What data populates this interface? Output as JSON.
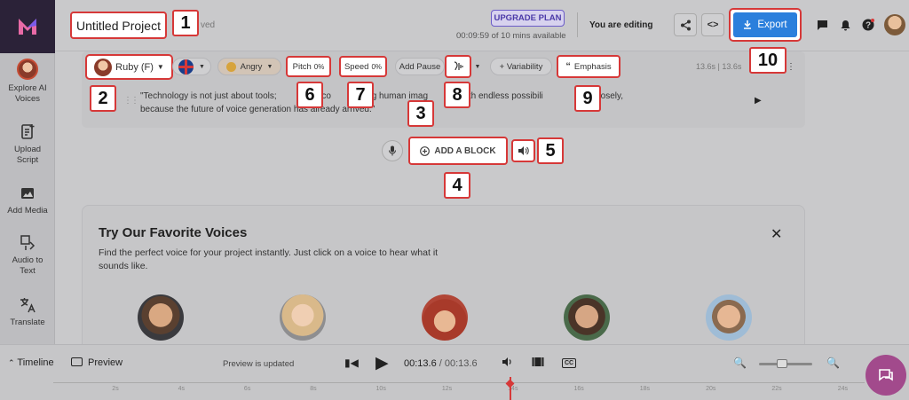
{
  "sidebar": {
    "items": [
      {
        "label_1": "Explore AI",
        "label_2": "Voices"
      },
      {
        "label_1": "Upload",
        "label_2": "Script"
      },
      {
        "label_1": "Add Media",
        "label_2": ""
      },
      {
        "label_1": "Audio to",
        "label_2": "Text"
      },
      {
        "label_1": "Translate",
        "label_2": ""
      }
    ]
  },
  "header": {
    "project_title": "Untitled Project",
    "saved_status": "ved",
    "upgrade_label": "UPGRADE PLAN",
    "time_available": "00:09:59 of 10 mins available",
    "editing_label": "You are editing",
    "code_label": "<>",
    "export_label": "Export"
  },
  "block": {
    "voice_name": "Ruby (F)",
    "emotion": "Angry",
    "pitch_label": "Pitch",
    "pitch_value": "0%",
    "speed_label": "Speed",
    "speed_value": "0%",
    "add_pause": "Add Pause",
    "variability": "+ Variability",
    "emphasis": "Emphasis",
    "timing": "13.6s | 13.6s",
    "script_text_line1": "\"Technology is not just about tools;",
    "script_text_mid": "but co",
    "script_text_mid2": "ing human imag",
    "script_text_mid3": "n with endless possibili",
    "script_text_mid4": "sten closely,",
    "script_text_line2": "because the future of voice generation has already arrived.\""
  },
  "add_block_label": "ADD A BLOCK",
  "card": {
    "title": "Try Our Favorite Voices",
    "subtitle": "Find the perfect voice for your project instantly. Just click on a voice to hear what it sounds like."
  },
  "timeline": {
    "timeline_label": "Timeline",
    "preview_label": "Preview",
    "updated": "Preview is updated",
    "current_time": "00:13.6",
    "separator": " / ",
    "total_time": "00:13.6",
    "cc_label": "CC",
    "ticks": [
      "2s",
      "4s",
      "6s",
      "8s",
      "10s",
      "12s",
      "14s",
      "16s",
      "18s",
      "20s",
      "22s",
      "24s"
    ]
  },
  "callouts": [
    "1",
    "2",
    "3",
    "4",
    "5",
    "6",
    "7",
    "8",
    "9",
    "10"
  ],
  "colors": {
    "callout_border": "#d63838",
    "export_blue": "#2b7fdc",
    "logo_bg": "#2b2238",
    "upgrade_purple": "#6b5cc8"
  }
}
